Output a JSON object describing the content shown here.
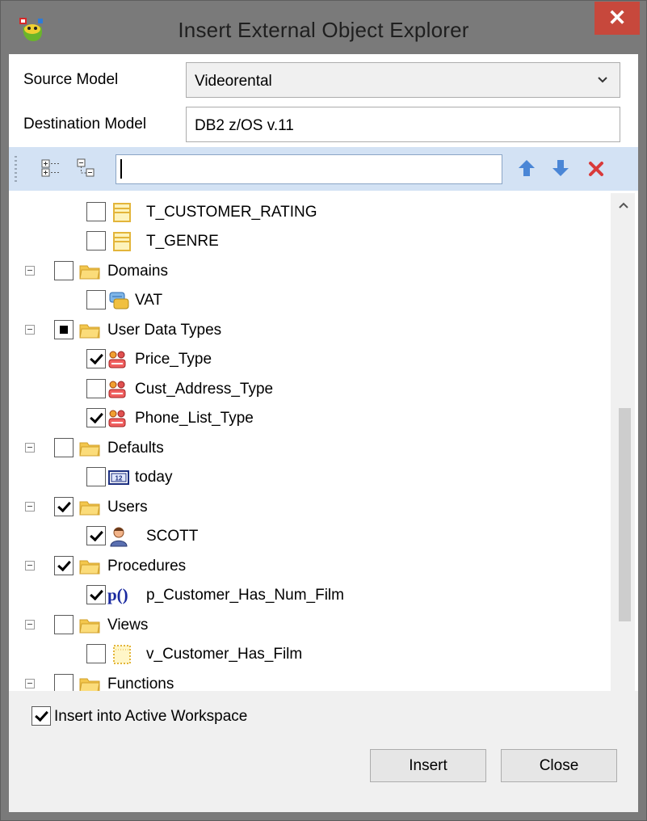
{
  "window": {
    "title": "Insert External Object Explorer",
    "close_glyph": "✕"
  },
  "form": {
    "source_model_label": "Source Model",
    "source_model_value": "Videorental",
    "destination_model_label": "Destination Model",
    "destination_model_value": "DB2 z/OS v.11"
  },
  "toolbar": {
    "search_value": "",
    "icons": [
      "expand-all-icon",
      "collapse-all-icon",
      "arrow-up-icon",
      "arrow-down-icon",
      "clear-icon"
    ]
  },
  "tree": {
    "t_customer_rating": "T_CUSTOMER_RATING",
    "t_genre": "T_GENRE",
    "domains": "Domains",
    "vat": "VAT",
    "user_data_types": "User Data Types",
    "price_type": "Price_Type",
    "cust_address_type": "Cust_Address_Type",
    "phone_list_type": "Phone_List_Type",
    "defaults": "Defaults",
    "today": "today",
    "users": "Users",
    "scott": "SCOTT",
    "procedures": "Procedures",
    "p_customer_has_num_film": "p_Customer_Has_Num_Film",
    "procedure_glyph": "p()",
    "views": "Views",
    "v_customer_has_film": "v_Customer_Has_Film",
    "functions": "Functions",
    "today_icon_text": "12"
  },
  "footer": {
    "insert_active_label": "Insert into Active Workspace",
    "insert_active_checked": true,
    "insert_button": "Insert",
    "close_button": "Close"
  },
  "colors": {
    "titlebar": "#7a7a7a",
    "close": "#c7483c",
    "toolbar": "#d3e2f4",
    "folder": "#f3c74d",
    "arrow": "#4a86d6"
  }
}
